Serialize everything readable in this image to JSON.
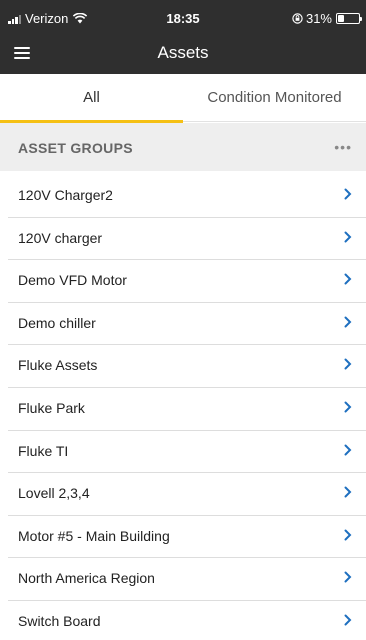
{
  "status_bar": {
    "carrier": "Verizon",
    "time": "18:35",
    "battery_percent": "31%",
    "battery_level": 0.31
  },
  "nav": {
    "title": "Assets",
    "menu_icon": "hamburger-menu-icon"
  },
  "tabs": [
    {
      "label": "All",
      "active": true
    },
    {
      "label": "Condition Monitored",
      "active": false
    }
  ],
  "section": {
    "title": "ASSET GROUPS",
    "more_label": "•••"
  },
  "asset_groups": [
    {
      "label": "120V Charger2"
    },
    {
      "label": "120V charger"
    },
    {
      "label": "Demo VFD Motor"
    },
    {
      "label": "Demo chiller"
    },
    {
      "label": "Fluke Assets"
    },
    {
      "label": "Fluke Park"
    },
    {
      "label": "Fluke TI"
    },
    {
      "label": "Lovell 2,3,4"
    },
    {
      "label": "Motor #5 - Main Building"
    },
    {
      "label": "North America Region"
    },
    {
      "label": "Switch Board"
    }
  ],
  "colors": {
    "header_bg": "#2f2f2f",
    "tab_indicator": "#f5c014",
    "chevron": "#1e6fbf",
    "section_bg": "#eeeeee"
  }
}
